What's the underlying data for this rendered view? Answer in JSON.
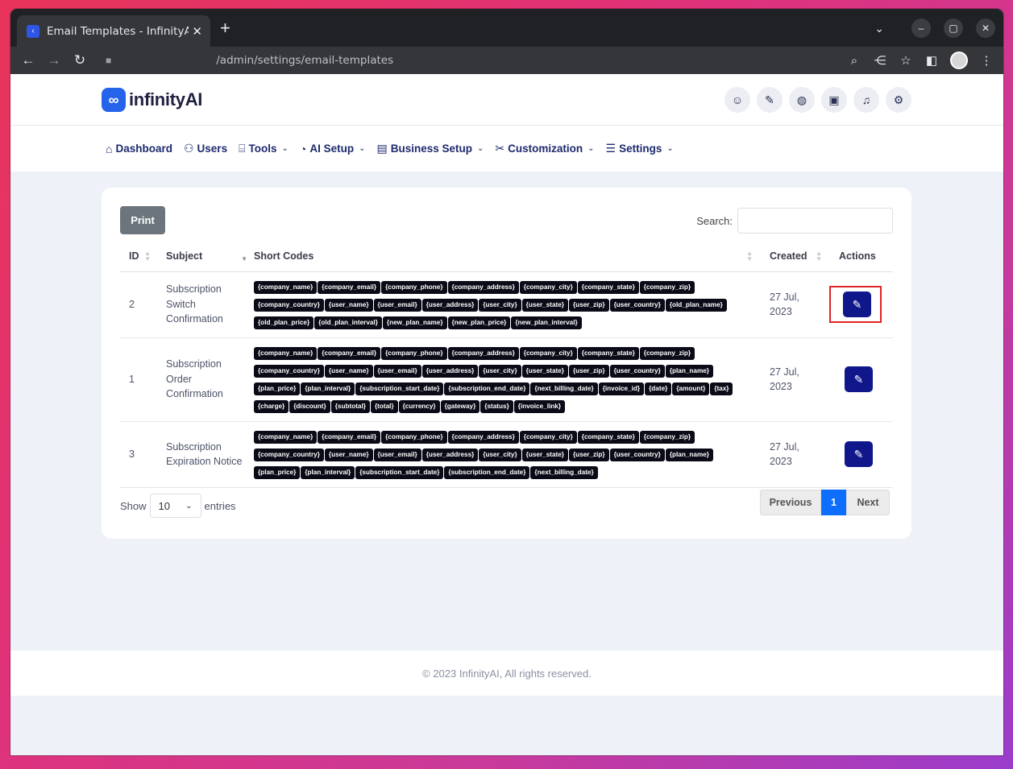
{
  "browser": {
    "tab_title": "Email Templates - InfinityAI",
    "url": "/admin/settings/email-templates",
    "new_tab": "+",
    "tab_close": "✕"
  },
  "header": {
    "logo_mark": "∞",
    "logo_text": "infinityAI",
    "icons": [
      "user-icon",
      "swatch-icon",
      "globe-icon",
      "card-icon",
      "bell-icon",
      "user-settings-icon"
    ]
  },
  "menu": {
    "items": [
      {
        "label": "Dashboard",
        "icon": "home-icon",
        "caret": false
      },
      {
        "label": "Users",
        "icon": "users-icon",
        "caret": false
      },
      {
        "label": "Tools",
        "icon": "toolbox-icon",
        "caret": true
      },
      {
        "label": "AI Setup",
        "icon": "gauge-icon",
        "caret": true
      },
      {
        "label": "Business Setup",
        "icon": "building-icon",
        "caret": true
      },
      {
        "label": "Customization",
        "icon": "tools-icon",
        "caret": true
      },
      {
        "label": "Settings",
        "icon": "sliders-icon",
        "caret": true
      }
    ]
  },
  "card": {
    "print_label": "Print",
    "search_label": "Search:",
    "search_value": "",
    "columns": [
      "ID",
      "Subject",
      "Short Codes",
      "Created",
      "Actions"
    ],
    "rows": [
      {
        "id": "2",
        "subject": [
          "Subscription",
          "Switch",
          "Confirmation"
        ],
        "codes": [
          "{company_name}",
          "{company_email}",
          "{company_phone}",
          "{company_address}",
          "{company_city}",
          "{company_state}",
          "{company_zip}",
          "{company_country}",
          "{user_name}",
          "{user_email}",
          "{user_address}",
          "{user_city}",
          "{user_state}",
          "{user_zip}",
          "{user_country}",
          "{old_plan_name}",
          "{old_plan_price}",
          "{old_plan_interval}",
          "{new_plan_name}",
          "{new_plan_price}",
          "{new_plan_interval}"
        ],
        "created": [
          "27 Jul,",
          "2023"
        ],
        "highlighted": true
      },
      {
        "id": "1",
        "subject": [
          "Subscription",
          "Order",
          "Confirmation"
        ],
        "codes": [
          "{company_name}",
          "{company_email}",
          "{company_phone}",
          "{company_address}",
          "{company_city}",
          "{company_state}",
          "{company_zip}",
          "{company_country}",
          "{user_name}",
          "{user_email}",
          "{user_address}",
          "{user_city}",
          "{user_state}",
          "{user_zip}",
          "{user_country}",
          "{plan_name}",
          "{plan_price}",
          "{plan_interval}",
          "{subscription_start_date}",
          "{subscription_end_date}",
          "{next_billing_date}",
          "{invoice_id}",
          "{date}",
          "{amount}",
          "{tax}",
          "{charge}",
          "{discount}",
          "{subtotal}",
          "{total}",
          "{currency}",
          "{gateway}",
          "{status}",
          "{invoice_link}"
        ],
        "created": [
          "27 Jul,",
          "2023"
        ],
        "highlighted": false
      },
      {
        "id": "3",
        "subject": [
          "Subscription",
          "Expiration Notice"
        ],
        "codes": [
          "{company_name}",
          "{company_email}",
          "{company_phone}",
          "{company_address}",
          "{company_city}",
          "{company_state}",
          "{company_zip}",
          "{company_country}",
          "{user_name}",
          "{user_email}",
          "{user_address}",
          "{user_city}",
          "{user_state}",
          "{user_zip}",
          "{user_country}",
          "{plan_name}",
          "{plan_price}",
          "{plan_interval}",
          "{subscription_start_date}",
          "{subscription_end_date}",
          "{next_billing_date}"
        ],
        "created": [
          "27 Jul,",
          "2023"
        ],
        "highlighted": false
      }
    ],
    "show_label": "Show",
    "show_value": "10",
    "entries_label": "entries",
    "pager": {
      "previous": "Previous",
      "current": "1",
      "next": "Next"
    }
  },
  "footer": {
    "text": "© 2023 InfinityAI, All rights reserved."
  },
  "colors": {
    "brand": "#2563eb",
    "action": "#10178a",
    "highlight": "#e02424",
    "pager_active": "#0d6efd"
  }
}
